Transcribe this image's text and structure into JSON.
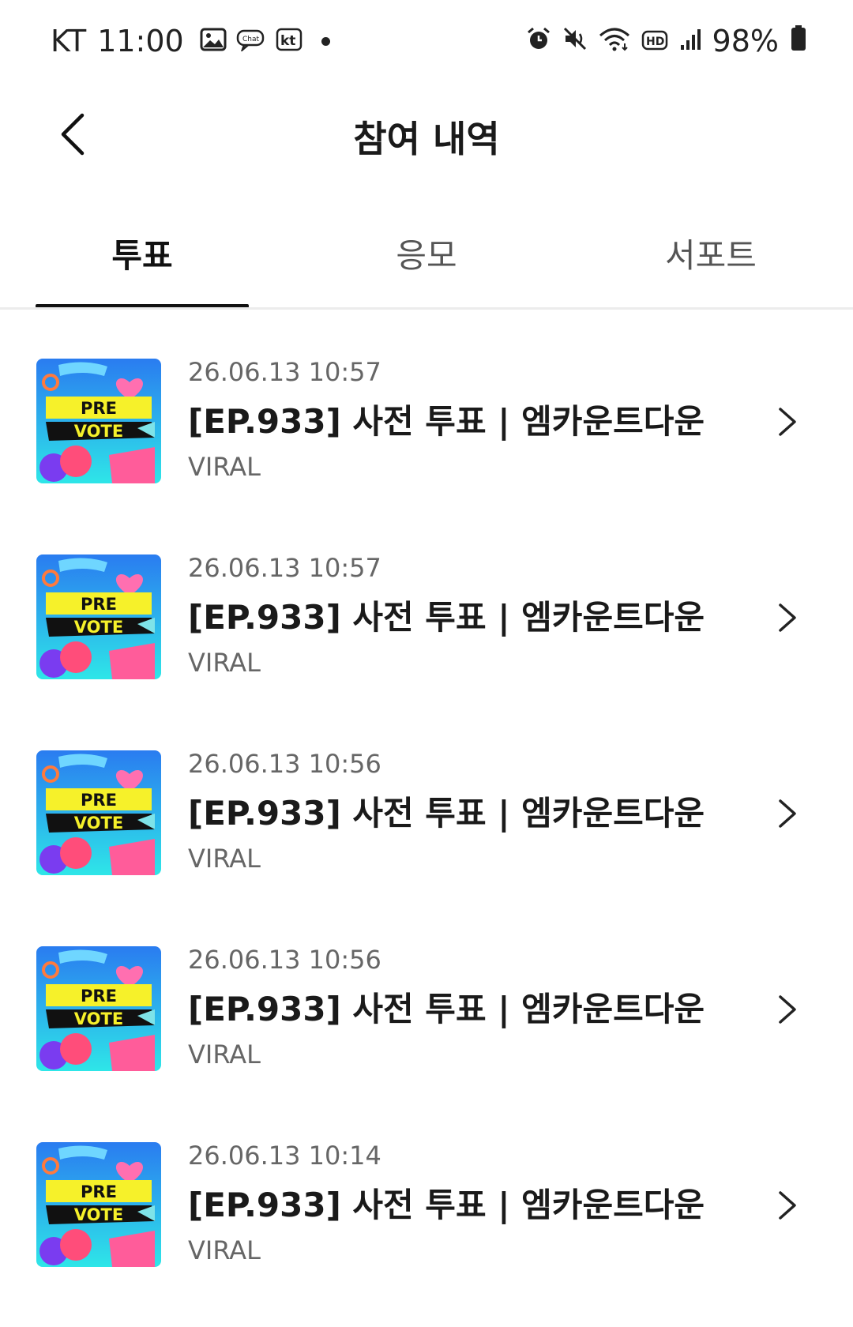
{
  "status_bar": {
    "carrier": "KT",
    "time": "11:00",
    "left_icons": [
      "gallery-icon",
      "chat-icon",
      "kt-icon"
    ],
    "right_icons": [
      "alarm-icon",
      "mute-icon",
      "wifi-icon",
      "hd-icon",
      "signal-icon"
    ],
    "battery_pct": "98%"
  },
  "header": {
    "title": "참여 내역",
    "back_icon": "chevron-left-icon"
  },
  "tabs": [
    {
      "label": "투표",
      "active": true
    },
    {
      "label": "응모",
      "active": false
    },
    {
      "label": "서포트",
      "active": false
    }
  ],
  "thumbnail": {
    "line1": "PRE",
    "line2": "VOTE"
  },
  "items": [
    {
      "date": "26.06.13 10:57",
      "title": "[EP.933] 사전 투표 | 엠카운트다운",
      "category": "VIRAL"
    },
    {
      "date": "26.06.13 10:57",
      "title": "[EP.933] 사전 투표 | 엠카운트다운",
      "category": "VIRAL"
    },
    {
      "date": "26.06.13 10:56",
      "title": "[EP.933] 사전 투표 | 엠카운트다운",
      "category": "VIRAL"
    },
    {
      "date": "26.06.13 10:56",
      "title": "[EP.933] 사전 투표 | 엠카운트다운",
      "category": "VIRAL"
    },
    {
      "date": "26.06.13 10:14",
      "title": "[EP.933] 사전 투표 | 엠카운트다운",
      "category": "VIRAL"
    }
  ],
  "colors": {
    "text_primary": "#111111",
    "text_secondary": "#666666",
    "divider": "#ececec",
    "thumb_blue": "#2a7cf0",
    "thumb_cyan": "#2ee6e8",
    "thumb_pink": "#ff5c9a",
    "thumb_yellow": "#f6f12a"
  }
}
